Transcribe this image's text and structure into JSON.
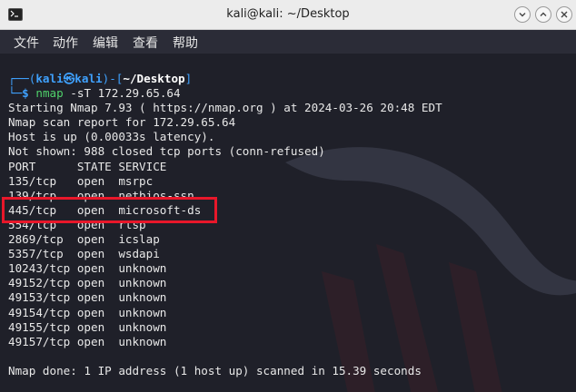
{
  "window": {
    "title": "kali@kali: ~/Desktop",
    "app_icon": "terminal-icon",
    "controls": [
      "minimize-icon",
      "maximize-icon",
      "close-icon"
    ]
  },
  "menu": {
    "items": [
      "文件",
      "动作",
      "编辑",
      "查看",
      "帮助"
    ]
  },
  "prompt": {
    "open": "┌──(",
    "user": "kali",
    "at": "㉿",
    "host": "kali",
    "mid": ")-[",
    "path": "~/Desktop",
    "close": "]",
    "dollar_prefix": "└─",
    "dollar": "$",
    "cmd": "nmap",
    "args": " -sT 172.29.65.64"
  },
  "output": {
    "starting": "Starting Nmap 7.93 ( https://nmap.org ) at 2024-03-26 20:48 EDT",
    "report": "Nmap scan report for 172.29.65.64",
    "host_up": "Host is up (0.00033s latency).",
    "not_shown": "Not shown: 988 closed tcp ports (conn-refused)",
    "header": "PORT      STATE SERVICE",
    "ports": [
      "135/tcp   open  msrpc",
      "139/tcp   open  netbios-ssn",
      "445/tcp   open  microsoft-ds",
      "554/tcp   open  rtsp",
      "2869/tcp  open  icslap",
      "5357/tcp  open  wsdapi",
      "10243/tcp open  unknown",
      "49152/tcp open  unknown",
      "49153/tcp open  unknown",
      "49154/tcp open  unknown",
      "49155/tcp open  unknown",
      "49157/tcp open  unknown"
    ],
    "blank": "",
    "done": "Nmap done: 1 IP address (1 host up) scanned in 15.39 seconds"
  },
  "colors": {
    "prompt_blue": "#3fa2ff",
    "command_green": "#4fd16a",
    "highlight_red": "#e8172a"
  }
}
